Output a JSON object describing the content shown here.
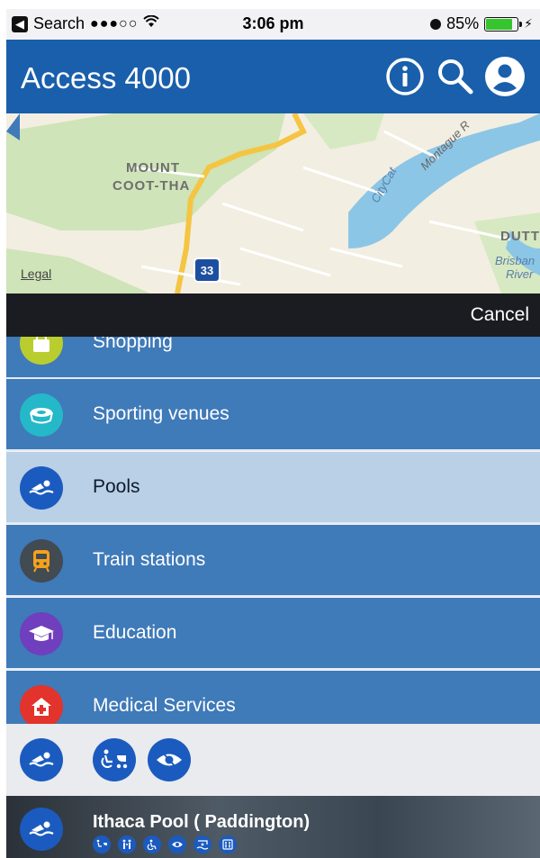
{
  "status_bar": {
    "back_label": "Search",
    "time": "3:06 pm",
    "battery": "85%",
    "battery_level": 0.85
  },
  "header": {
    "title": "Access 4000",
    "icons": [
      "info-icon",
      "search-icon",
      "profile-icon"
    ]
  },
  "map": {
    "labels": [
      "Mount",
      "Coot-tha",
      "CityCat",
      "Montague R",
      "Dutt",
      "Brisban",
      "River"
    ],
    "route_badge": "33",
    "legal": "Legal"
  },
  "cancel_label": "Cancel",
  "categories": [
    {
      "label": "Shopping",
      "icon": "shopping-bag-icon",
      "color": "#b9cd2f",
      "selected": false
    },
    {
      "label": "Sporting venues",
      "icon": "stadium-icon",
      "color": "#24b8c9",
      "selected": false
    },
    {
      "label": "Pools",
      "icon": "swimmer-icon",
      "color": "#1b5bbf",
      "selected": true
    },
    {
      "label": "Train stations",
      "icon": "train-icon",
      "color": "#424a52",
      "selected": false
    },
    {
      "label": "Education",
      "icon": "graduation-cap-icon",
      "color": "#6f3fbd",
      "selected": false
    },
    {
      "label": "Medical Services",
      "icon": "medical-house-icon",
      "color": "#e2332c",
      "selected": false
    }
  ],
  "filter_icons": [
    "swimmer-icon",
    "wheelchair-pram-icon",
    "low-vision-icon"
  ],
  "venue": {
    "name": "Ithaca Pool ( Paddington)",
    "features": [
      "wheelchair-pram-icon",
      "family-icon",
      "wheelchair-icon",
      "low-vision-icon",
      "pool-hoist-icon",
      "lift-icon"
    ]
  },
  "colors": {
    "header_blue": "#1a5fab",
    "list_blue": "#3f7ab9",
    "selected_row": "#b9d0e6",
    "icon_blue": "#1b5bbf"
  }
}
